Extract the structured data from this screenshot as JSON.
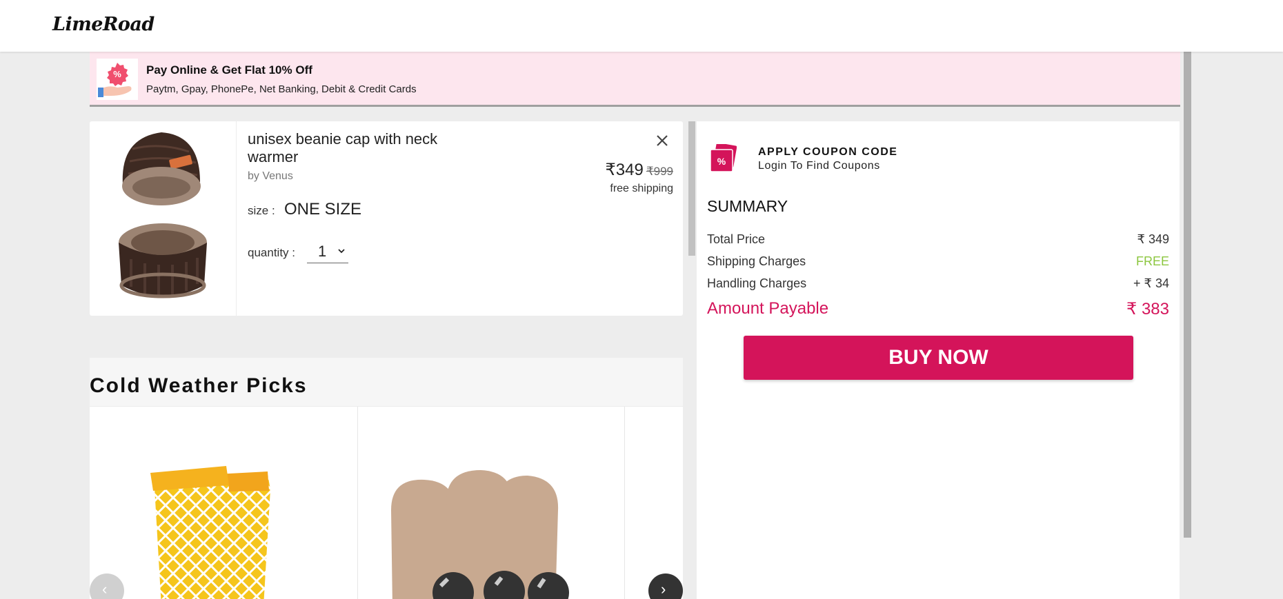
{
  "header": {
    "logo": "LimeRoad"
  },
  "offer": {
    "title": "Pay Online & Get Flat 10% Off",
    "subtitle": "Paytm, Gpay, PhonePe, Net Banking, Debit & Credit Cards"
  },
  "cart_item": {
    "name": "unisex beanie cap with neck warmer",
    "brand": "by Venus",
    "size_label": "size :",
    "size_value": "ONE SIZE",
    "quantity_label": "quantity :",
    "quantity_value": "1",
    "price": "₹349",
    "mrp": "₹999",
    "shipping": "free shipping"
  },
  "coupon": {
    "title": "APPLY COUPON CODE",
    "subtitle": "Login To Find Coupons"
  },
  "summary": {
    "title": "SUMMARY",
    "rows": [
      {
        "label": "Total Price",
        "value": "₹ 349"
      },
      {
        "label": "Shipping Charges",
        "value": "FREE"
      },
      {
        "label": "Handling Charges",
        "value": "+ ₹ 34"
      }
    ],
    "payable_label": "Amount Payable",
    "payable_value": "₹ 383"
  },
  "buy_button": "BUY NOW",
  "recommendations": {
    "title": "Cold Weather Picks",
    "prev_icon": "‹",
    "next_icon": "›"
  },
  "colors": {
    "brand_pink": "#d4145a",
    "free_green": "#8cc63f",
    "offer_bg": "#fde6ee"
  }
}
